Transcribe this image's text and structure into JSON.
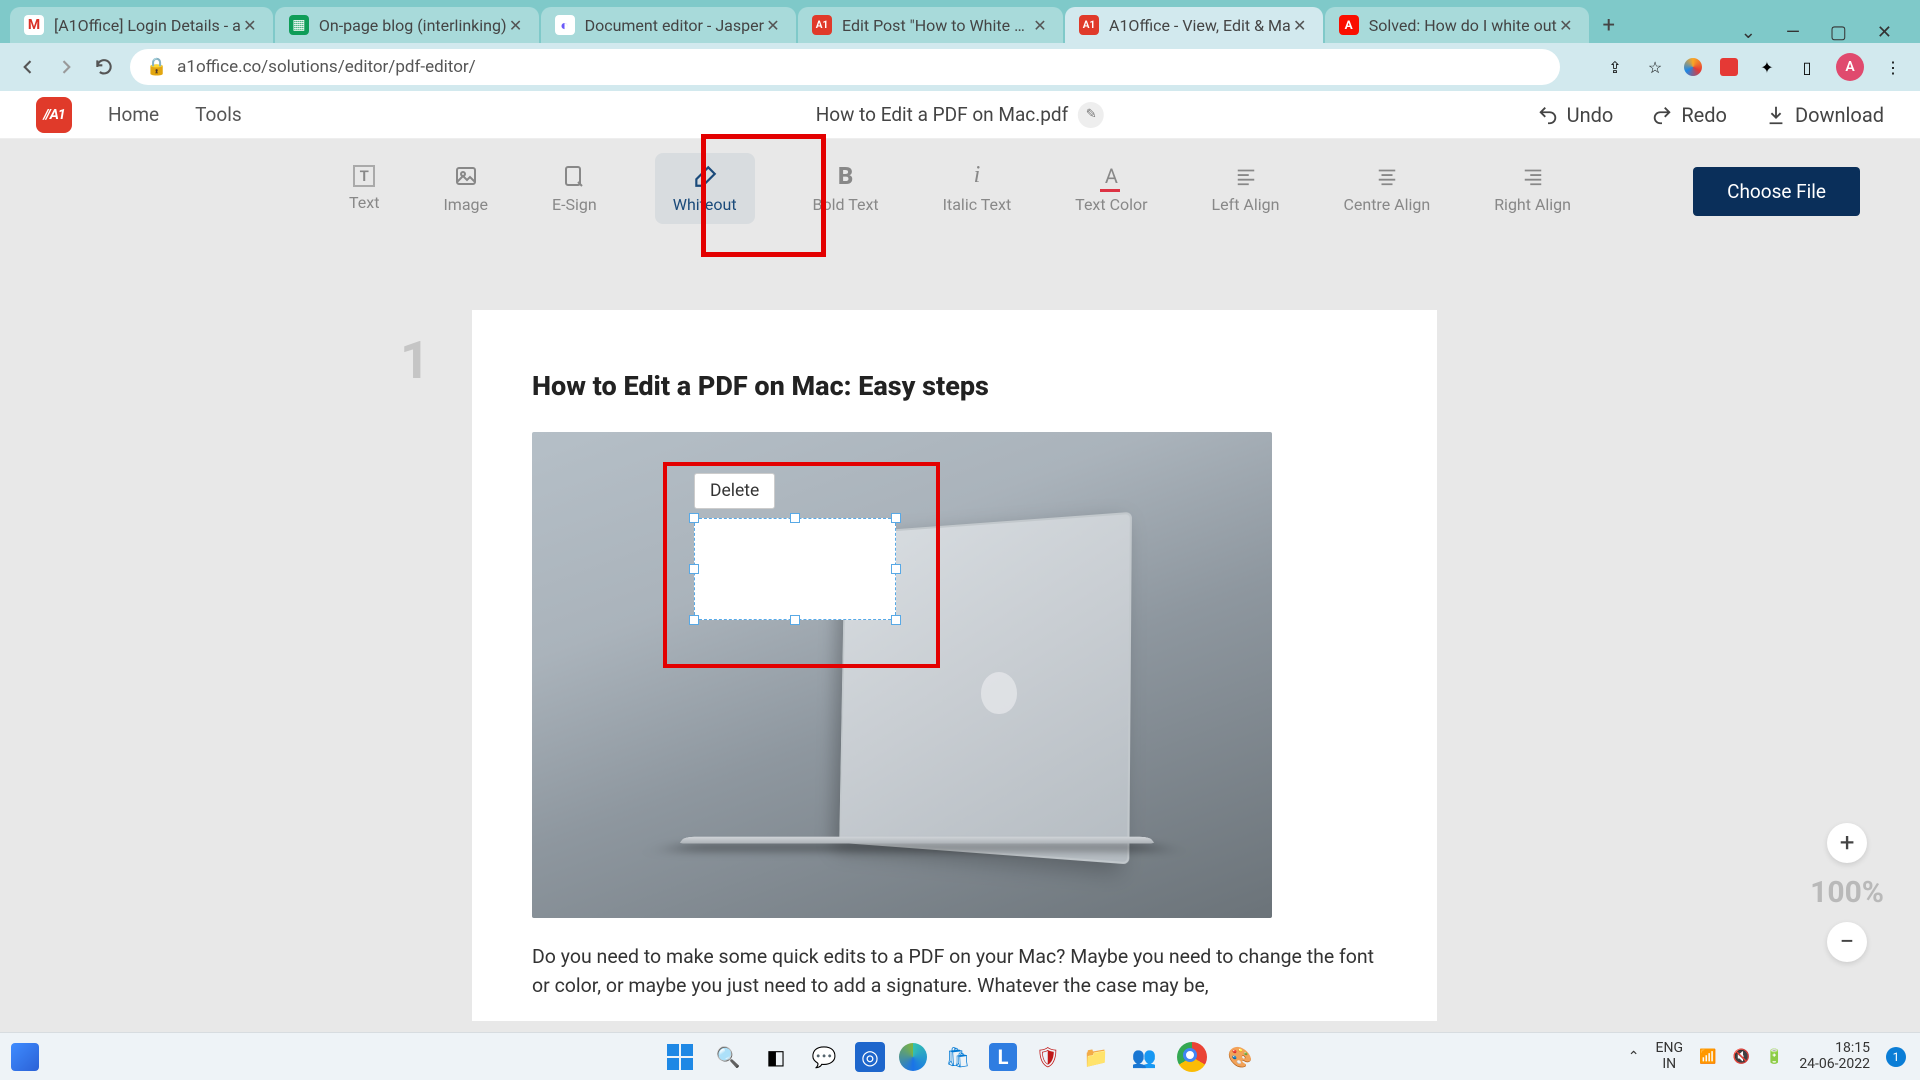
{
  "browser": {
    "tabs": [
      {
        "title": "[A1Office] Login Details - a",
        "icon": "M",
        "iconBg": "#fff"
      },
      {
        "title": "On-page blog (interlinking)",
        "icon": "▦",
        "iconBg": "#0f9d58"
      },
      {
        "title": "Document editor - Jasper",
        "icon": "◐",
        "iconBg": "#fff"
      },
      {
        "title": "Edit Post \"How to White Ou",
        "icon": "A1",
        "iconBg": "#e03a2a"
      },
      {
        "title": "A1Office - View, Edit & Ma",
        "icon": "A1",
        "iconBg": "#e03a2a",
        "active": true
      },
      {
        "title": "Solved: How do I white out",
        "icon": "A",
        "iconBg": "#d8261d"
      }
    ],
    "url": "a1office.co/solutions/editor/pdf-editor/",
    "avatar": "A"
  },
  "app": {
    "logo": "//A1",
    "nav": {
      "home": "Home",
      "tools": "Tools"
    },
    "docTitle": "How to Edit a PDF on Mac.pdf",
    "actions": {
      "undo": "Undo",
      "redo": "Redo",
      "download": "Download"
    }
  },
  "toolbar": {
    "items": [
      {
        "label": "Text",
        "glyph": "T"
      },
      {
        "label": "Image",
        "glyph": "▢"
      },
      {
        "label": "E-Sign",
        "glyph": "✎"
      },
      {
        "label": "Whiteout",
        "glyph": "⬭",
        "active": true
      },
      {
        "label": "Bold Text",
        "glyph": "B"
      },
      {
        "label": "Italic Text",
        "glyph": "i"
      },
      {
        "label": "Text Color",
        "glyph": "A"
      },
      {
        "label": "Left Align",
        "glyph": "≡"
      },
      {
        "label": "Centre Align",
        "glyph": "≡"
      },
      {
        "label": "Right Align",
        "glyph": "≡"
      }
    ],
    "chooseFile": "Choose File"
  },
  "document": {
    "pageNumber": "1",
    "heading": "How to Edit a PDF on Mac: Easy steps",
    "paragraph": "Do you need to make some quick edits to a PDF on your Mac? Maybe you need to change the font or color, or maybe you just need to add a signature. Whatever the case may be,",
    "deleteLabel": "Delete"
  },
  "zoom": {
    "percent": "100%"
  },
  "taskbar": {
    "lang1": "ENG",
    "lang2": "IN",
    "time": "18:15",
    "date": "24-06-2022",
    "badge": "1"
  }
}
